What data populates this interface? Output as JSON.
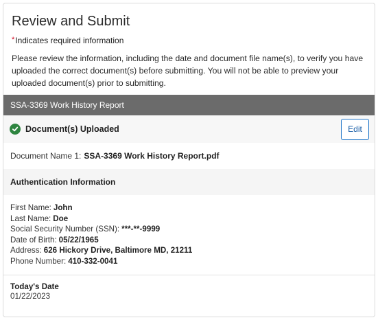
{
  "header": {
    "title": "Review and Submit",
    "required_star": "*",
    "required_note": "Indicates required information",
    "intro": "Please review the information, including the date and document file name(s), to verify you have uploaded the correct document(s) before submitting. You will not be able to preview your uploaded document(s) prior to submitting."
  },
  "section": {
    "title": "SSA-3369 Work History Report"
  },
  "upload_status": {
    "text": "Document(s) Uploaded",
    "icon": "check-circle-icon",
    "icon_color": "#2e8540",
    "edit_label": "Edit"
  },
  "document": {
    "label": "Document Name 1:",
    "value": "SSA-3369 Work History Report.pdf"
  },
  "auth": {
    "title": "Authentication Information",
    "fields": [
      {
        "label": "First Name:",
        "value": "John"
      },
      {
        "label": "Last Name:",
        "value": "Doe"
      },
      {
        "label": "Social Security Number (SSN):",
        "value": "***-**-9999"
      },
      {
        "label": "Date of Birth:",
        "value": "05/22/1965"
      },
      {
        "label": "Address:",
        "value": "626 Hickory Drive, Baltimore MD, 21211"
      },
      {
        "label": "Phone Number:",
        "value": "410-332-0041"
      }
    ]
  },
  "today": {
    "label": "Today's Date",
    "value": "01/22/2023"
  },
  "colors": {
    "section_bar": "#6b6b6b",
    "edit_border": "#1a73c8",
    "required_star": "#d0021b"
  }
}
